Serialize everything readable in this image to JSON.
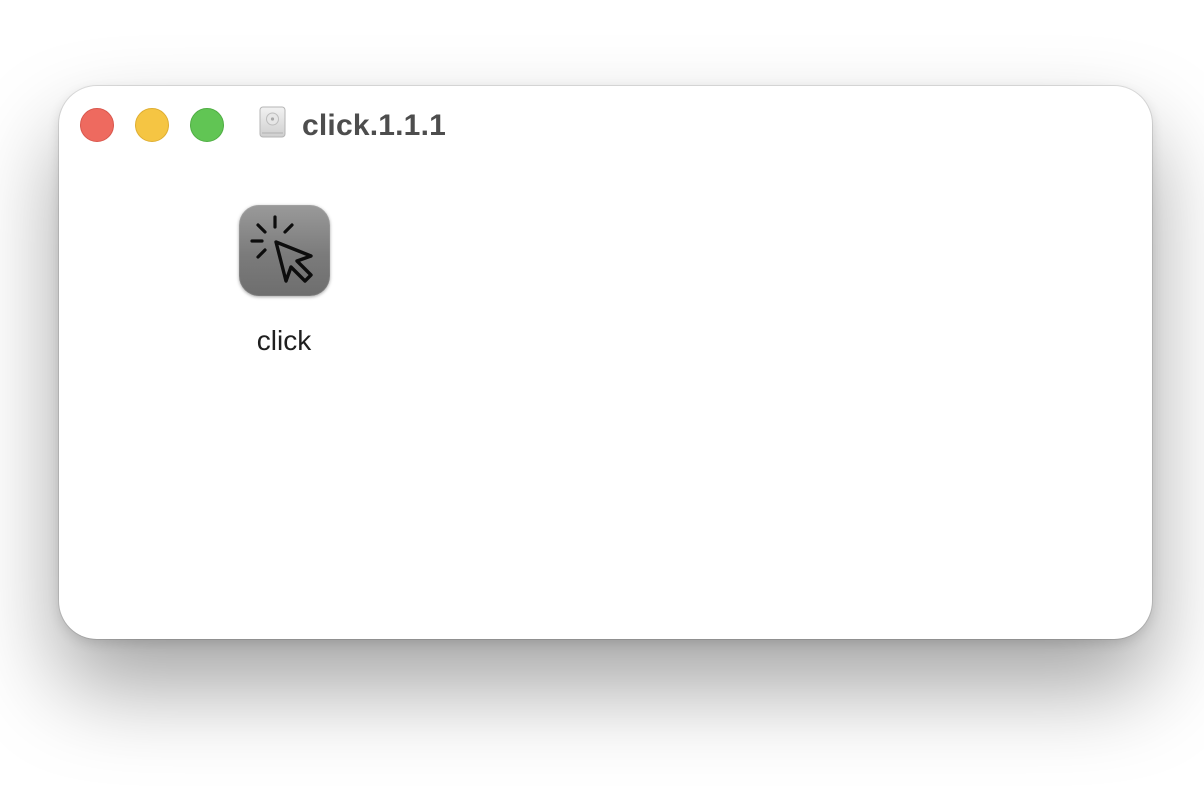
{
  "window": {
    "title": "click.1.1.1",
    "traffic_lights": {
      "close": "#ee6a5f",
      "minimize": "#f5c543",
      "zoom": "#61c554"
    },
    "proxy_icon": "disk-image-icon"
  },
  "content": {
    "items": [
      {
        "label": "click",
        "icon": "cursor-click-app-icon"
      }
    ]
  }
}
